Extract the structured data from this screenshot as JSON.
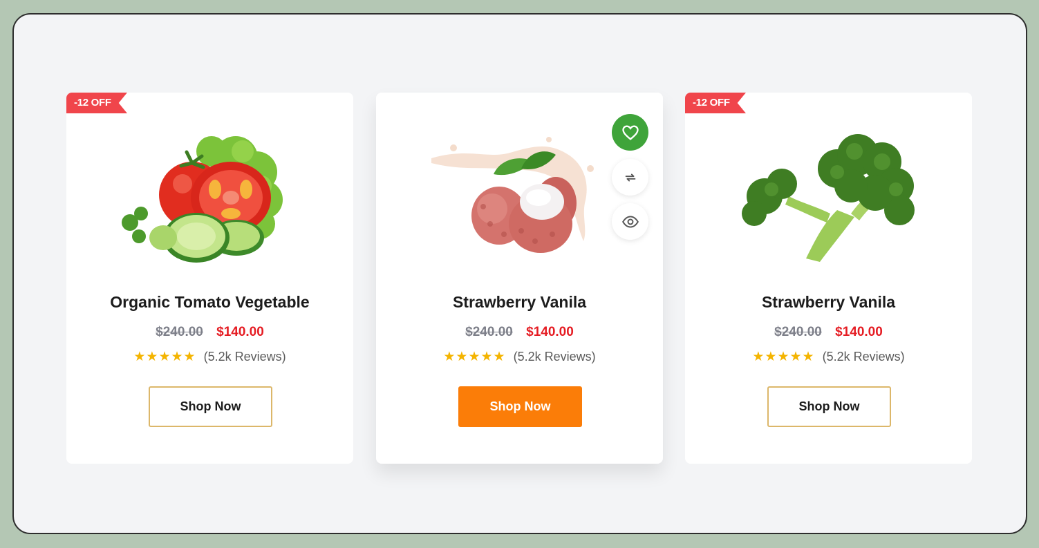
{
  "products": [
    {
      "badge": "-12 OFF",
      "title": "Organic Tomato Vegetable",
      "old_price": "$240.00",
      "price": "$140.00",
      "stars": "★★★★★",
      "reviews": "(5.2k Reviews)",
      "button": "Shop Now",
      "image": "tomato-cucumber-lettuce"
    },
    {
      "badge": "",
      "title": "Strawberry Vanila",
      "old_price": "$240.00",
      "price": "$140.00",
      "stars": "★★★★★",
      "reviews": "(5.2k Reviews)",
      "button": "Shop Now",
      "image": "lychee-splash",
      "actions": [
        "heart-icon",
        "compare-arrows-icon",
        "eye-icon"
      ]
    },
    {
      "badge": "-12 OFF",
      "title": "Strawberry Vanila",
      "old_price": "$240.00",
      "price": "$140.00",
      "stars": "★★★★★",
      "reviews": "(5.2k Reviews)",
      "button": "Shop Now",
      "image": "broccoli"
    }
  ],
  "colors": {
    "badge": "#f0454b",
    "price": "#e51c23",
    "star": "#f4b400",
    "button_primary": "#fb7d08",
    "button_border": "#dcb76a",
    "wishlist": "#3fa43a"
  }
}
